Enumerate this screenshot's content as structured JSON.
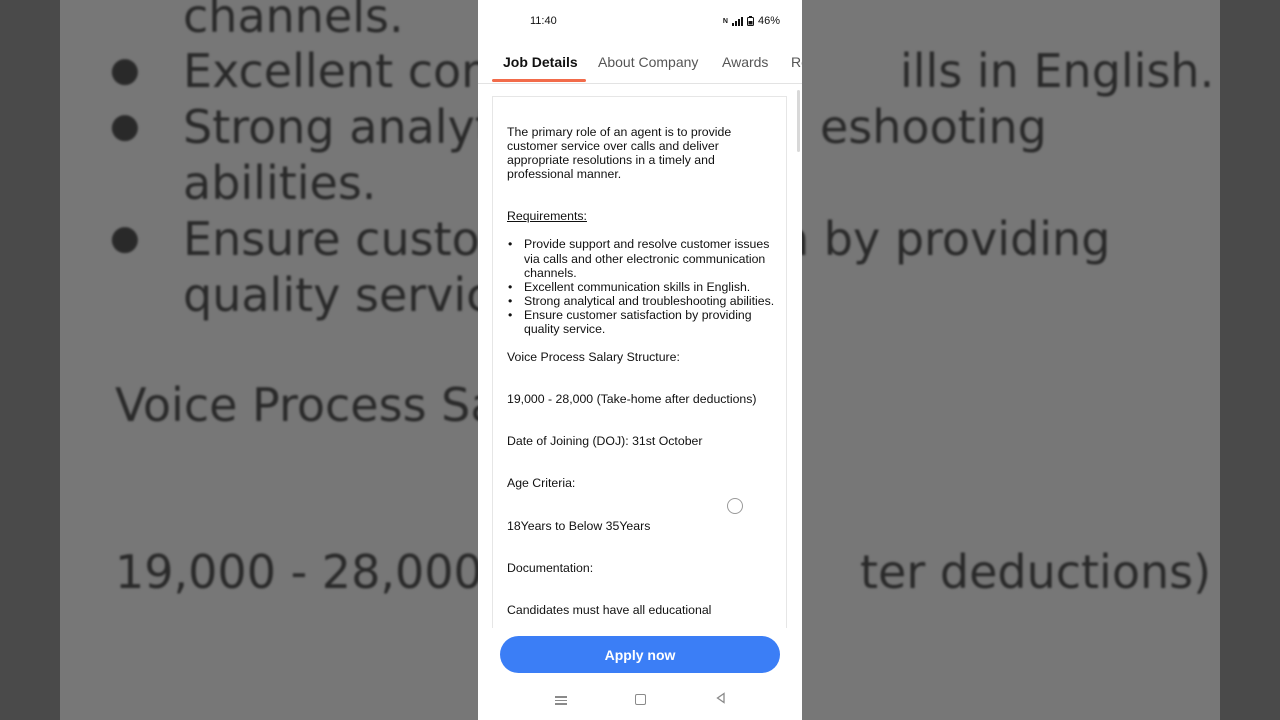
{
  "background": {
    "lines": [
      "channels.",
      "Excellent com",
      "ills in English.",
      "Strong analyti",
      "eshooting",
      "abilities.",
      "Ensure custor",
      "n by providing",
      "quality servic",
      "Voice Process Sa",
      "19,000 - 28,000",
      "ter deductions)"
    ]
  },
  "status": {
    "time": "11:40",
    "battery": "46%"
  },
  "tabs": [
    "Job Details",
    "About Company",
    "Awards",
    "Re"
  ],
  "job": {
    "intro": "The primary role of an agent is to provide customer service over calls and deliver appropriate resolutions in a timely and professional manner.",
    "requirements_heading": "Requirements:",
    "requirements": [
      "Provide support and resolve customer issues via calls and other electronic communication channels.",
      "Excellent communication skills in English.",
      "Strong analytical and troubleshooting abilities.",
      "Ensure customer satisfaction by providing quality service."
    ],
    "salary_heading": "Voice Process Salary Structure:",
    "salary": "19,000 - 28,000 (Take-home after deductions)",
    "doj": "Date of Joining (DOJ): 31st October",
    "age_heading": "Age Criteria:",
    "age": "18Years to Below 35Years",
    "doc_heading": "Documentation:",
    "doc": "Candidates must have all educational"
  },
  "apply_label": "Apply now",
  "colors": {
    "accent_tab": "#f26b4a",
    "apply_button": "#3b7ef6"
  }
}
